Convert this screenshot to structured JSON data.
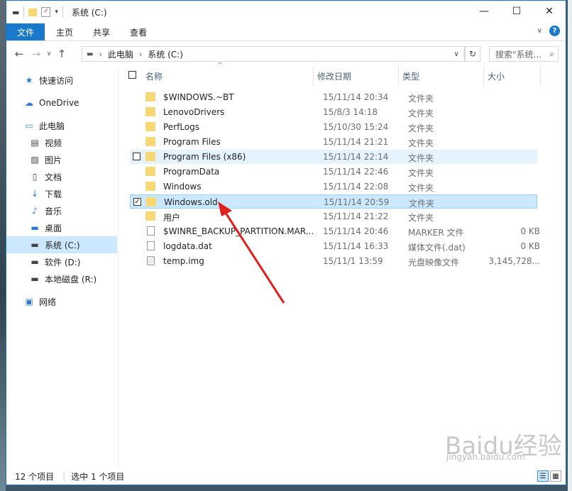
{
  "window": {
    "title": "系统 (C:)",
    "controls": {
      "minimize": "—",
      "maximize": "☐",
      "close": "✕"
    }
  },
  "ribbon": {
    "tabs": [
      "文件",
      "主页",
      "共享",
      "查看"
    ],
    "expand_icon": "chevron-down-icon",
    "help_icon": "?"
  },
  "address": {
    "crumbs": [
      "此电脑",
      "系统 (C:)"
    ],
    "search_placeholder": "搜索\"系统..."
  },
  "sidebar": {
    "items": [
      {
        "label": "快速访问",
        "icon": "star-icon",
        "color": "#2b78d4",
        "indent": 0
      },
      {
        "label": "OneDrive",
        "icon": "cloud-icon",
        "color": "#2b78d4",
        "indent": 0
      },
      {
        "label": "此电脑",
        "icon": "computer-icon",
        "color": "#3a8ed8",
        "indent": 0
      },
      {
        "label": "视频",
        "icon": "video-icon",
        "color": "#444444",
        "indent": 1
      },
      {
        "label": "图片",
        "icon": "pictures-icon",
        "color": "#444444",
        "indent": 1
      },
      {
        "label": "文档",
        "icon": "document-icon",
        "color": "#444444",
        "indent": 1
      },
      {
        "label": "下载",
        "icon": "download-icon",
        "color": "#2b78d4",
        "indent": 1
      },
      {
        "label": "音乐",
        "icon": "music-icon",
        "color": "#2b78d4",
        "indent": 1
      },
      {
        "label": "桌面",
        "icon": "desktop-icon",
        "color": "#2b78d4",
        "indent": 1
      },
      {
        "label": "系统 (C:)",
        "icon": "drive-c-icon",
        "color": "#444444",
        "indent": 1,
        "selected": true
      },
      {
        "label": "软件 (D:)",
        "icon": "drive-icon",
        "color": "#444444",
        "indent": 1
      },
      {
        "label": "本地磁盘 (R:)",
        "icon": "drive-icon",
        "color": "#444444",
        "indent": 1
      },
      {
        "label": "网络",
        "icon": "network-icon",
        "color": "#2b78d4",
        "indent": 0
      }
    ]
  },
  "columns": [
    "名称",
    "修改日期",
    "类型",
    "大小"
  ],
  "files": [
    {
      "name": "$WINDOWS.~BT",
      "date": "15/11/14 20:34",
      "type": "文件夹",
      "size": "",
      "kind": "folder"
    },
    {
      "name": "LenovoDrivers",
      "date": "15/8/3 14:18",
      "type": "文件夹",
      "size": "",
      "kind": "folder"
    },
    {
      "name": "PerfLogs",
      "date": "15/10/30 15:24",
      "type": "文件夹",
      "size": "",
      "kind": "folder"
    },
    {
      "name": "Program Files",
      "date": "15/11/14 21:21",
      "type": "文件夹",
      "size": "",
      "kind": "folder"
    },
    {
      "name": "Program Files (x86)",
      "date": "15/11/14 22:14",
      "type": "文件夹",
      "size": "",
      "kind": "folder",
      "state": "hover"
    },
    {
      "name": "ProgramData",
      "date": "15/11/14 22:46",
      "type": "文件夹",
      "size": "",
      "kind": "folder"
    },
    {
      "name": "Windows",
      "date": "15/11/14 22:08",
      "type": "文件夹",
      "size": "",
      "kind": "folder"
    },
    {
      "name": "Windows.old",
      "date": "15/11/14 20:59",
      "type": "文件夹",
      "size": "",
      "kind": "folder",
      "state": "selected"
    },
    {
      "name": "用户",
      "date": "15/11/14 21:22",
      "type": "文件夹",
      "size": "",
      "kind": "folder"
    },
    {
      "name": "$WINRE_BACKUP_PARTITION.MAR...",
      "date": "15/11/14 20:46",
      "type": "MARKER 文件",
      "size": "0 KB",
      "kind": "file"
    },
    {
      "name": "logdata.dat",
      "date": "15/11/14 16:33",
      "type": "媒体文件(.dat)",
      "size": "0 KB",
      "kind": "file"
    },
    {
      "name": "temp.img",
      "date": "15/11/1 13:59",
      "type": "光盘映像文件",
      "size": "3,145,728...",
      "kind": "disc"
    }
  ],
  "status": {
    "count": "12 个项目",
    "selection": "选中 1 个项目"
  },
  "watermark": {
    "text": "Baidu经验",
    "sub": "jingyan.baidu.com"
  },
  "colors": {
    "accent": "#1979ca",
    "selected": "#cce8ff",
    "hover": "#e5f3ff",
    "arrow": "#e0201c"
  }
}
